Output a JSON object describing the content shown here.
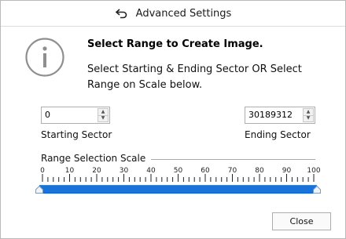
{
  "dialog": {
    "title": "Advanced Settings",
    "heading": "Select Range to Create Image.",
    "description": "Select Starting & Ending Sector OR Select Range on Scale below."
  },
  "start": {
    "value": "0",
    "label": "Starting Sector"
  },
  "end": {
    "value": "30189312",
    "label": "Ending Sector"
  },
  "scale": {
    "label": "Range Selection Scale",
    "ticks": [
      "0",
      "10",
      "20",
      "30",
      "40",
      "50",
      "60",
      "70",
      "80",
      "90",
      "100"
    ],
    "range_low_percent": 0,
    "range_high_percent": 100
  },
  "buttons": {
    "close": "Close"
  },
  "colors": {
    "range": "#1a73d8"
  }
}
